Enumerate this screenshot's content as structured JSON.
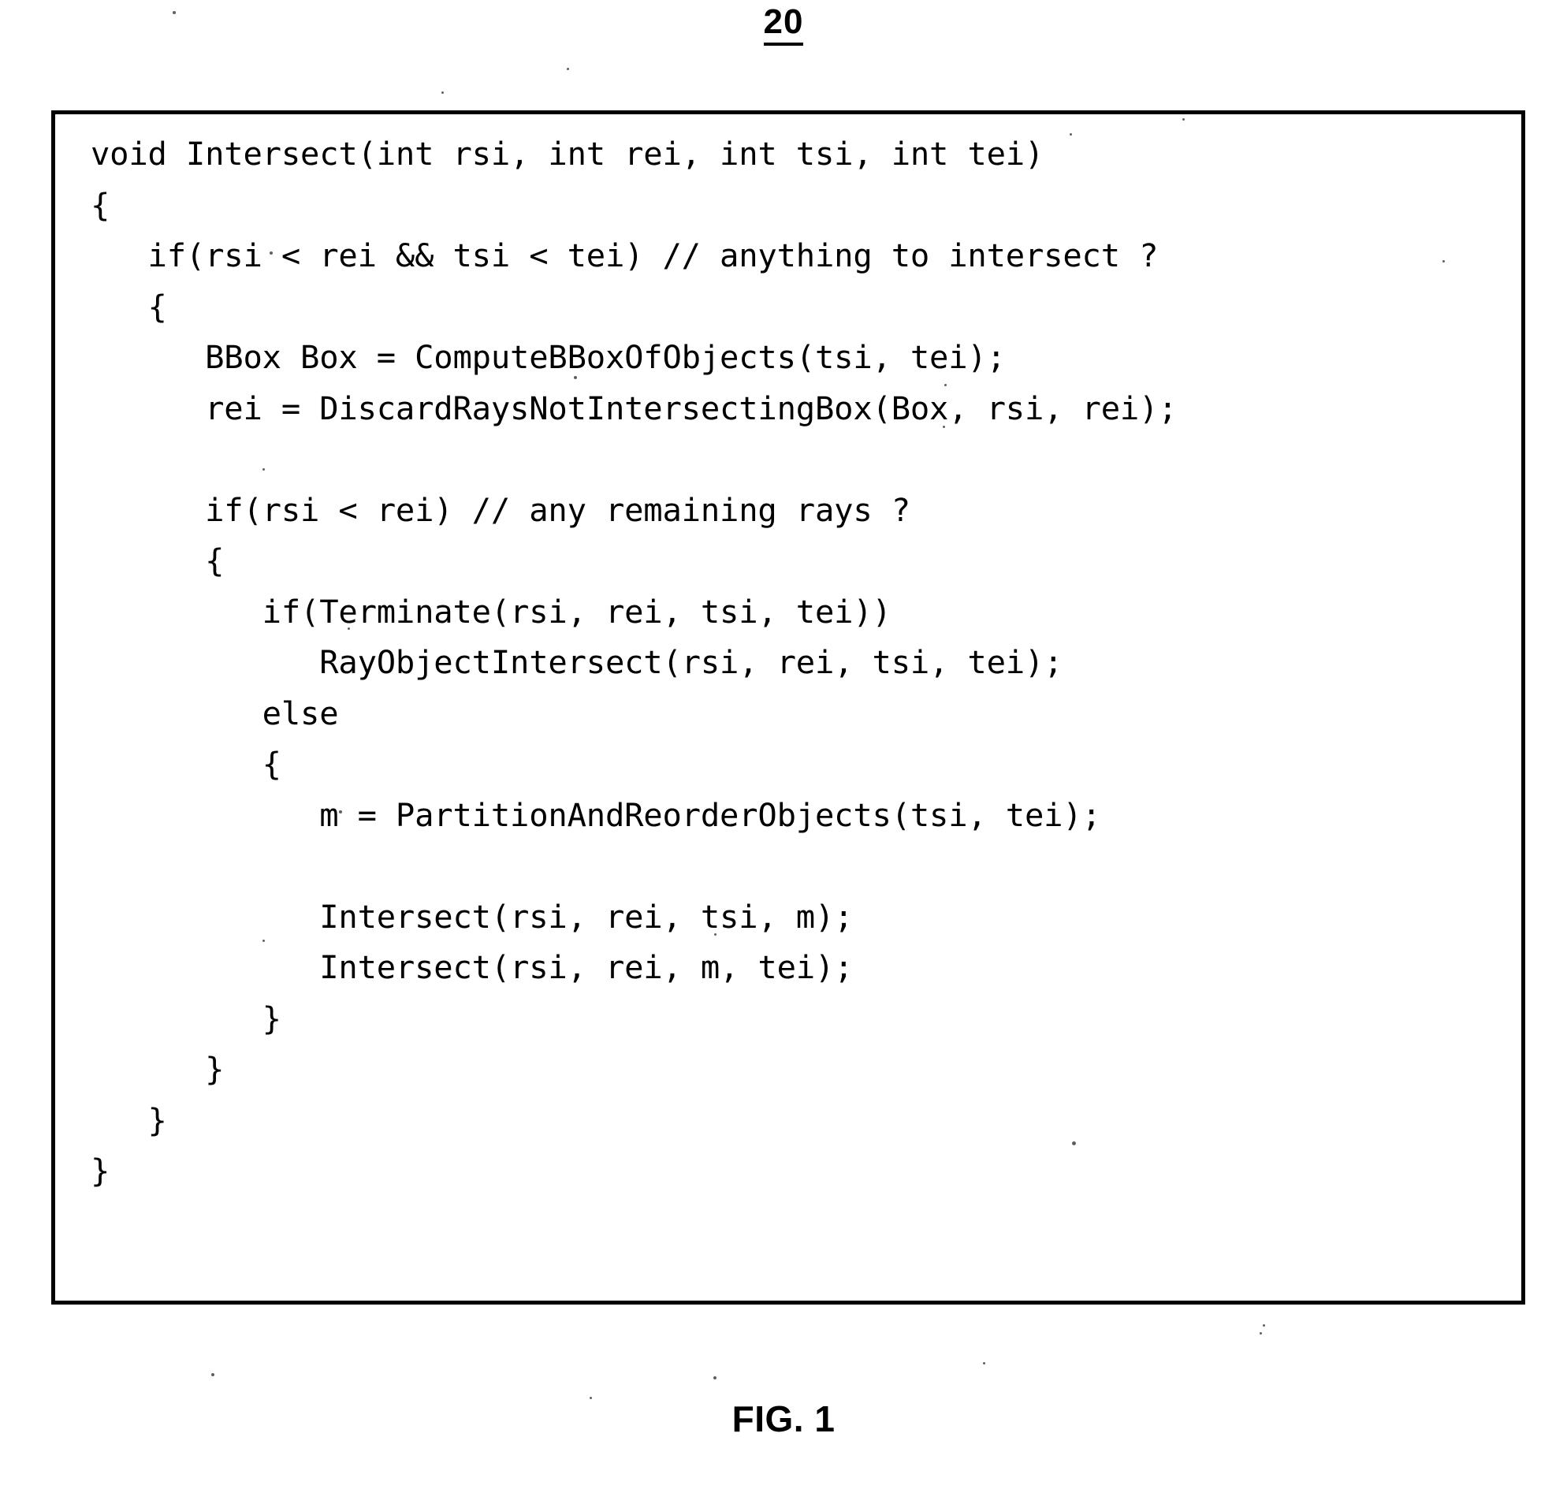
{
  "figure": {
    "reference_numeral": "20",
    "caption": "FIG. 1"
  },
  "code": {
    "language": "c",
    "lines": [
      "void Intersect(int rsi, int rei, int tsi, int tei)",
      "{",
      "   if(rsi < rei && tsi < tei) // anything to intersect ?",
      "   {",
      "      BBox Box = ComputeBBoxOfObjects(tsi, tei);",
      "      rei = DiscardRaysNotIntersectingBox(Box, rsi, rei);",
      "",
      "      if(rsi < rei) // any remaining rays ?",
      "      {",
      "         if(Terminate(rsi, rei, tsi, tei))",
      "            RayObjectIntersect(rsi, rei, tsi, tei);",
      "         else",
      "         {",
      "            m = PartitionAndReorderObjects(tsi, tei);",
      "",
      "            Intersect(rsi, rei, tsi, m);",
      "            Intersect(rsi, rei, m, tei);",
      "         }",
      "      }",
      "   }",
      "}"
    ]
  },
  "colors": {
    "ink": "#000000",
    "page": "#ffffff"
  }
}
